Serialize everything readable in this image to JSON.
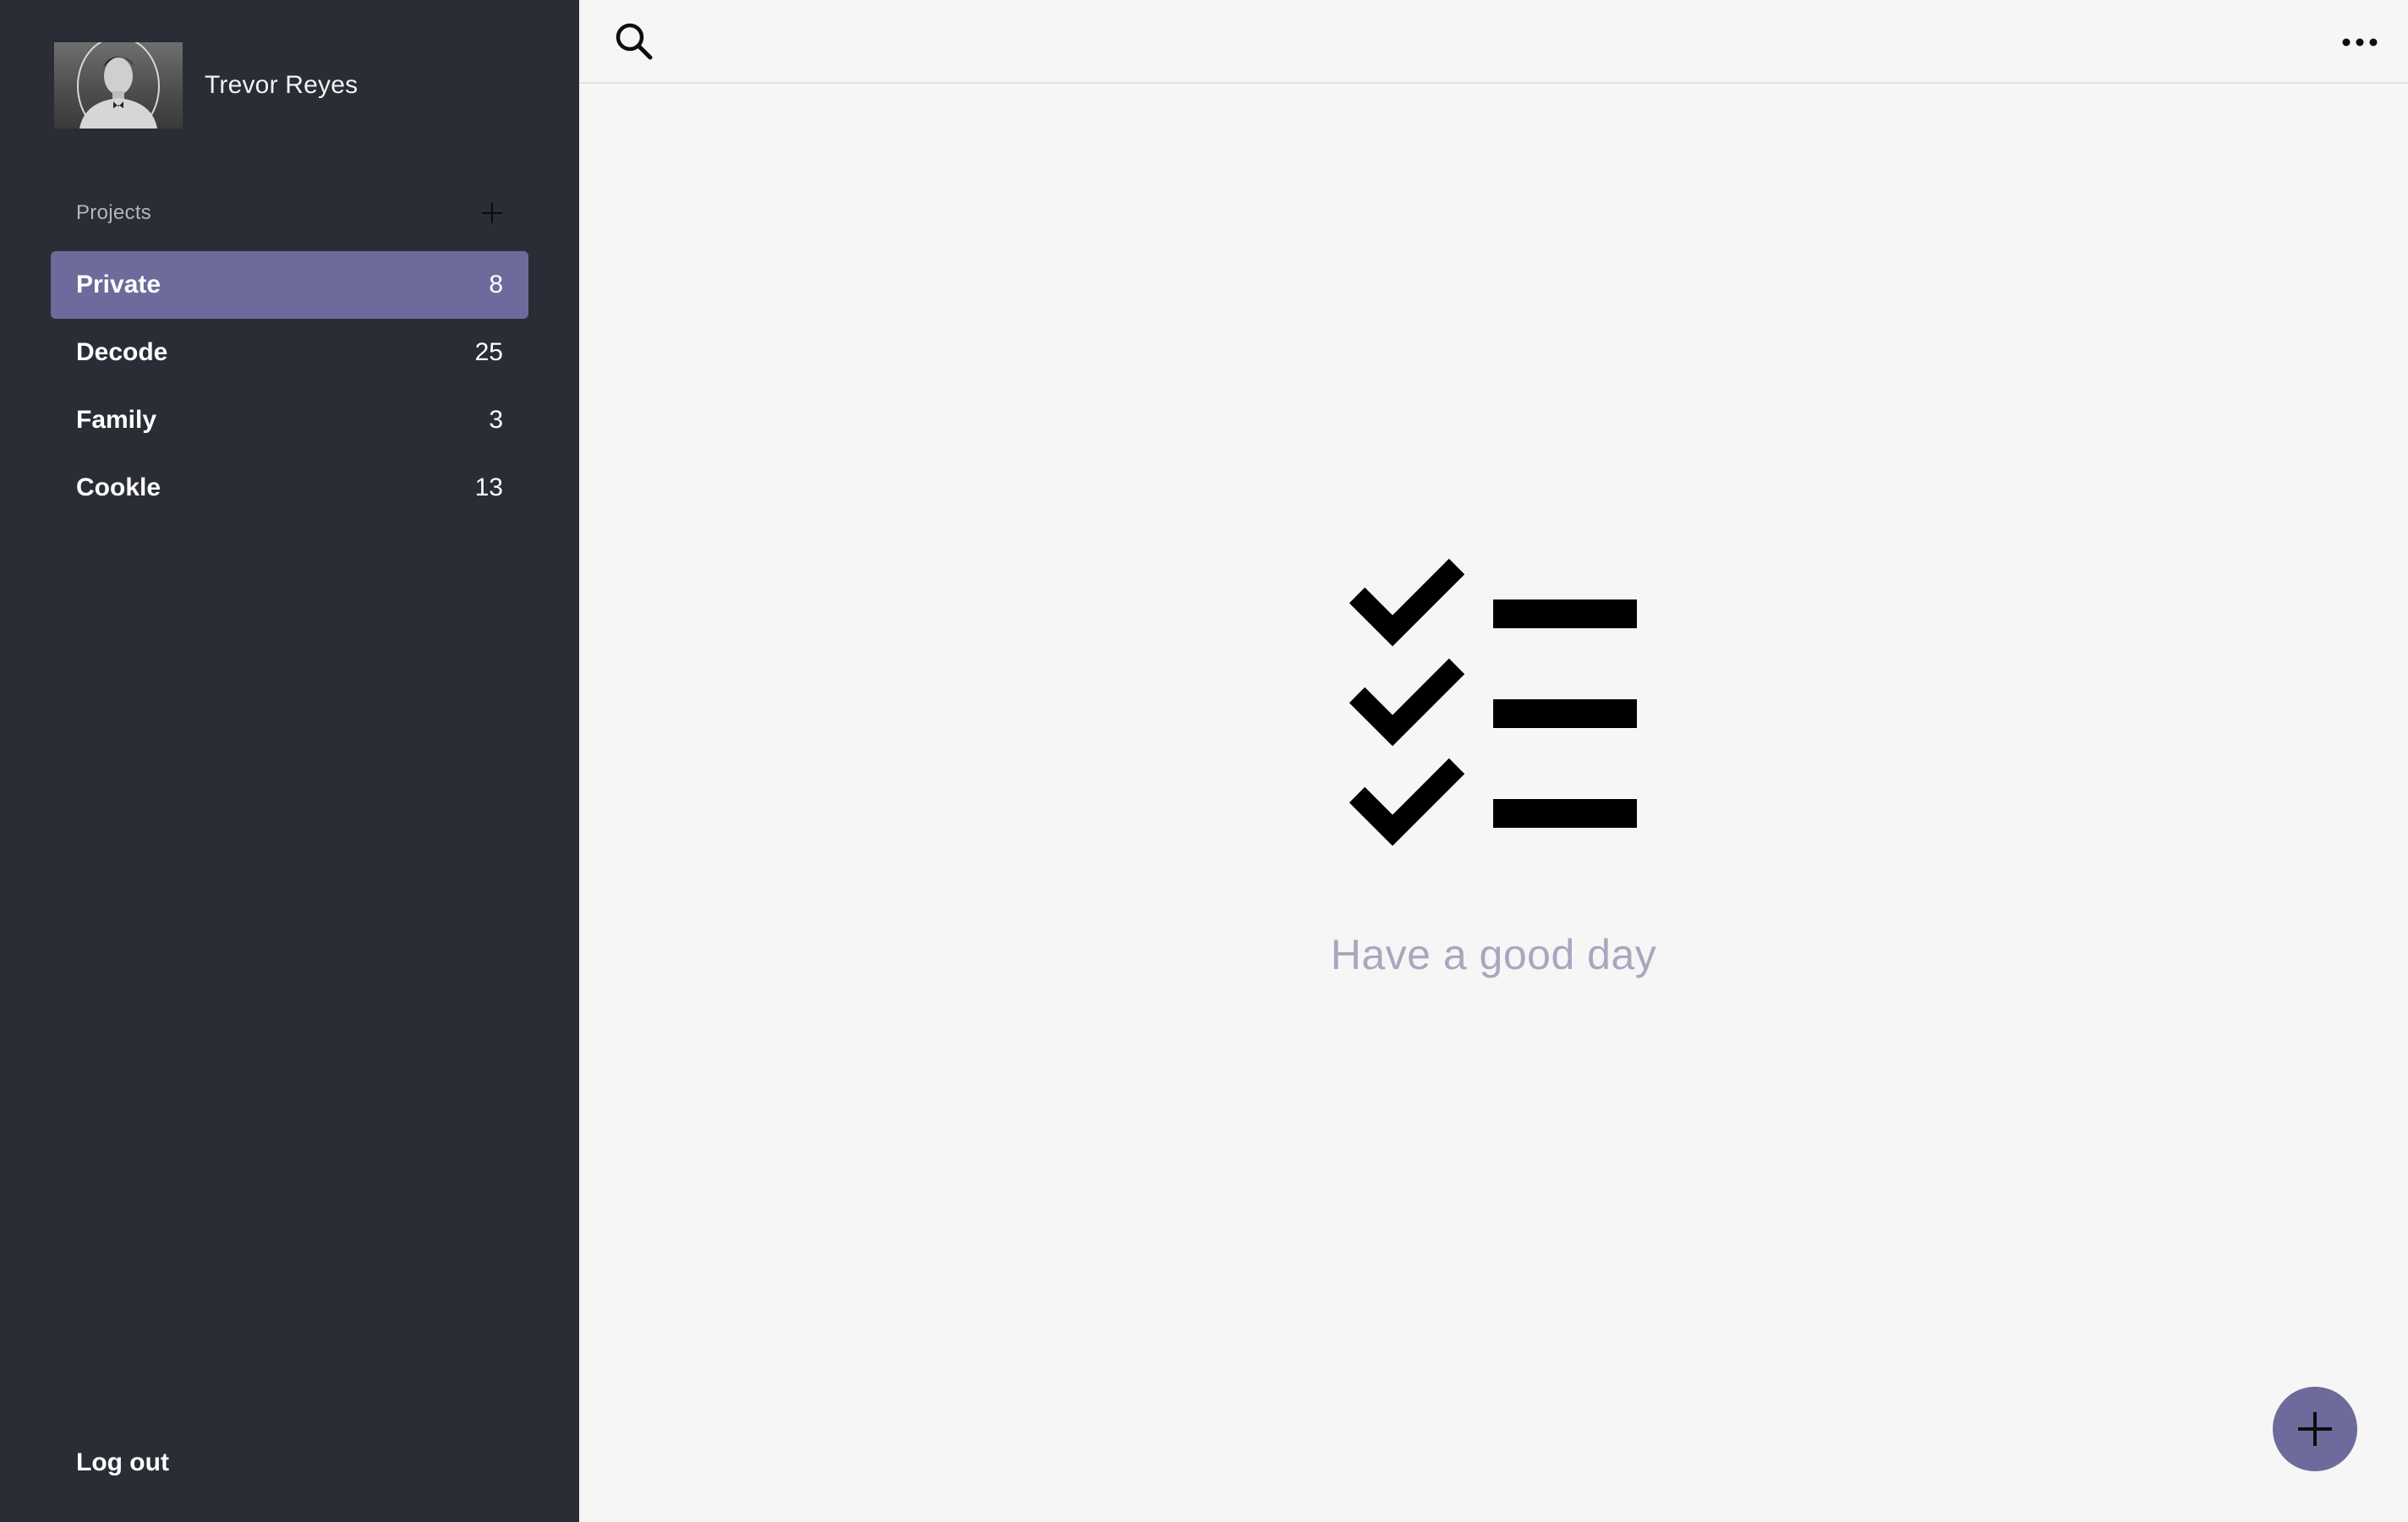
{
  "user": {
    "name": "Trevor Reyes"
  },
  "sidebar": {
    "projects_title": "Projects",
    "items": [
      {
        "label": "Private",
        "count": "8",
        "active": true
      },
      {
        "label": "Decode",
        "count": "25",
        "active": false
      },
      {
        "label": "Family",
        "count": "3",
        "active": false
      },
      {
        "label": "Cookle",
        "count": "13",
        "active": false
      }
    ],
    "logout_label": "Log out"
  },
  "main": {
    "empty_message": "Have a good day"
  },
  "icons": {
    "search": "search-icon",
    "more": "more-horizontal-icon",
    "add_project": "plus-icon",
    "fab": "plus-icon",
    "empty": "checklist-icon"
  },
  "colors": {
    "sidebar_bg": "#2a2d35",
    "accent": "#6c6b9c",
    "main_bg": "#f6f6f6",
    "empty_text": "#a9a7bf"
  }
}
